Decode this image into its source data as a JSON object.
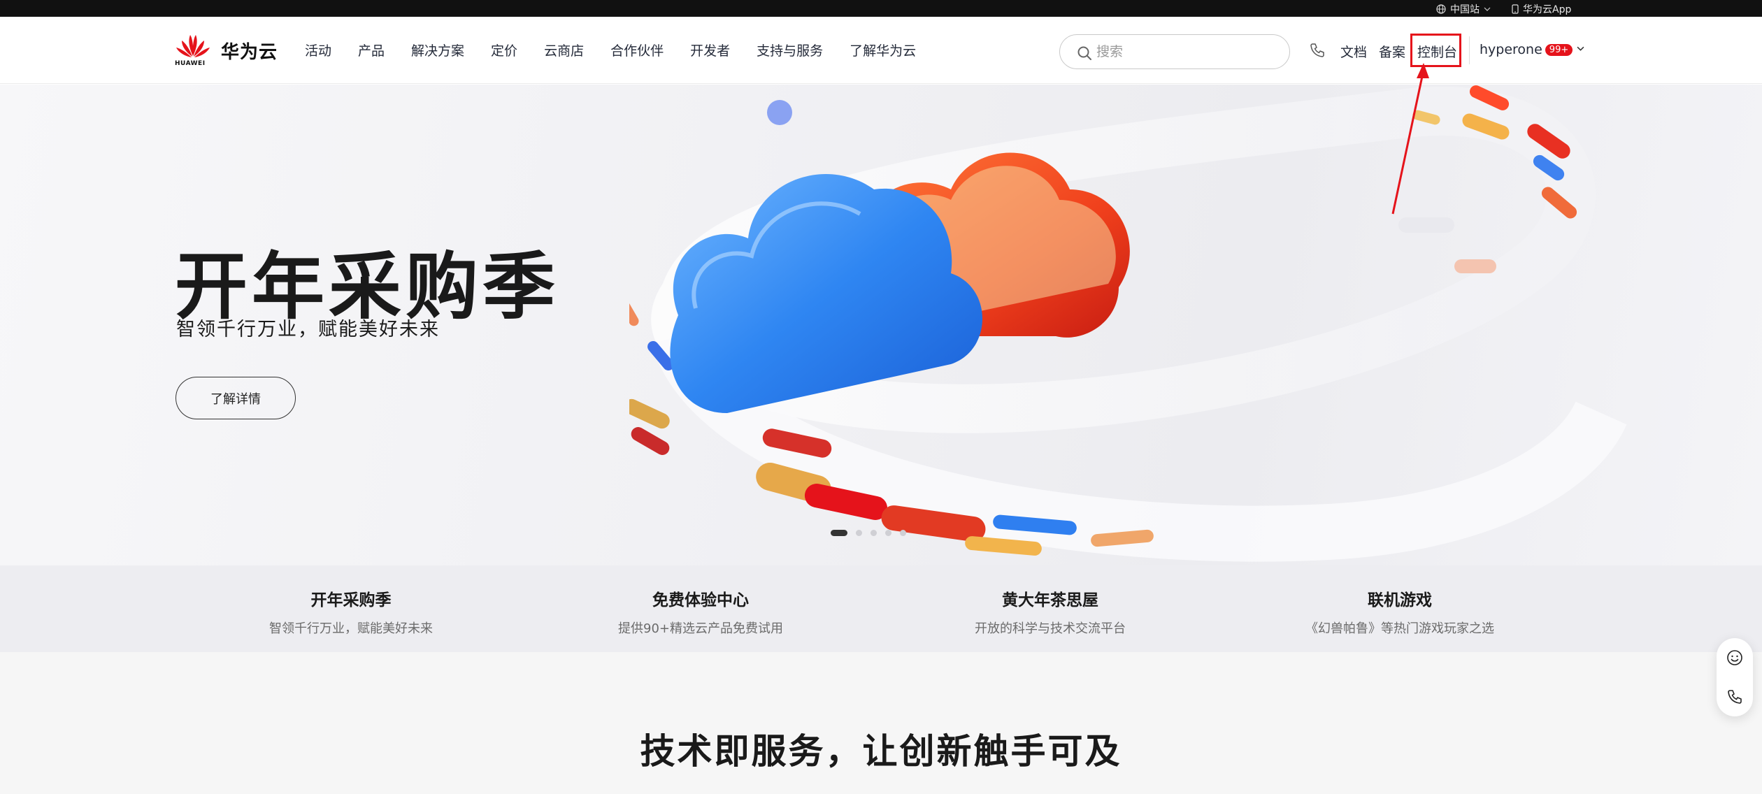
{
  "topbar": {
    "region_label": "中国站",
    "app_label": "华为云App"
  },
  "header": {
    "brand": "华为云",
    "brand_sub": "HUAWEI",
    "nav": [
      "活动",
      "产品",
      "解决方案",
      "定价",
      "云商店",
      "合作伙伴",
      "开发者",
      "支持与服务",
      "了解华为云"
    ],
    "search_placeholder": "搜索",
    "docs_label": "文档",
    "filing_label": "备案",
    "console_label": "控制台",
    "username": "hyperone",
    "notification_badge": "99+"
  },
  "hero": {
    "title": "开年采购季",
    "subtitle": "智领千行万业，赋能美好未来",
    "button_label": "了解详情",
    "slide_count": 5,
    "active_slide": 1
  },
  "strip": [
    {
      "title": "开年采购季",
      "subtitle": "智领千行万业，赋能美好未来"
    },
    {
      "title": "免费体验中心",
      "subtitle": "提供90+精选云产品免费试用"
    },
    {
      "title": "黄大年茶思屋",
      "subtitle": "开放的科学与技术交流平台"
    },
    {
      "title": "联机游戏",
      "subtitle": "《幻兽帕鲁》等热门游戏玩家之选"
    }
  ],
  "section": {
    "title": "技术即服务，让创新触手可及"
  },
  "colors": {
    "brand_red": "#e5131b",
    "text_dark": "#252b3a",
    "topbar_bg": "#111111"
  },
  "icons": [
    "globe-icon",
    "phone-mobile-icon",
    "search-icon",
    "phone-icon",
    "chevron-down-icon",
    "smiley-icon",
    "phone-call-icon"
  ]
}
